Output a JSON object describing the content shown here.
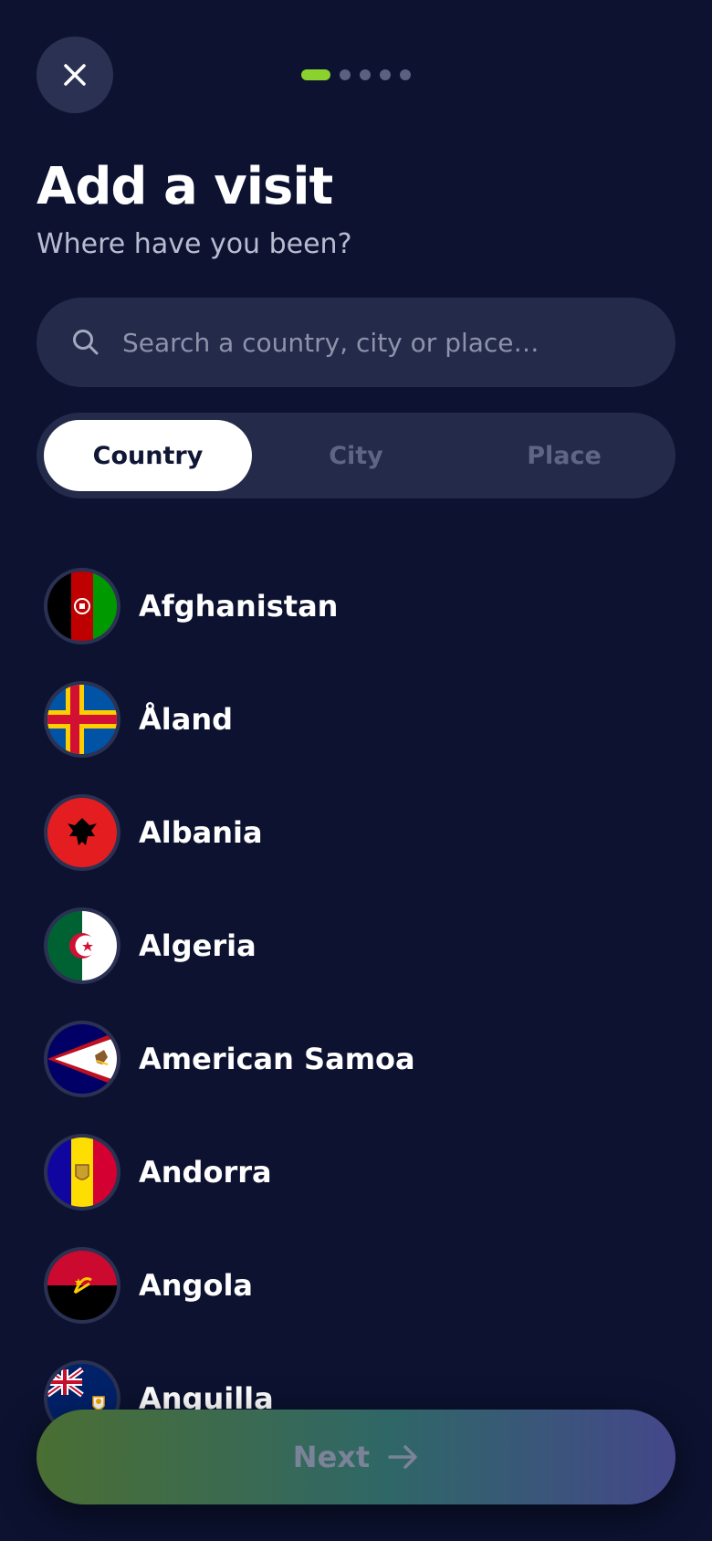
{
  "header": {
    "close_icon": "close-icon",
    "progress": {
      "total_steps": 5,
      "current_step": 1
    }
  },
  "title": "Add a visit",
  "subtitle": "Where have you been?",
  "search": {
    "icon": "search-icon",
    "placeholder": "Search a country, city or place…",
    "value": ""
  },
  "segments": [
    {
      "label": "Country",
      "selected": true
    },
    {
      "label": "City",
      "selected": false
    },
    {
      "label": "Place",
      "selected": false
    }
  ],
  "countries": [
    {
      "name": "Afghanistan",
      "flag_icon": "afghanistan-flag-icon"
    },
    {
      "name": "Åland",
      "flag_icon": "aland-flag-icon"
    },
    {
      "name": "Albania",
      "flag_icon": "albania-flag-icon"
    },
    {
      "name": "Algeria",
      "flag_icon": "algeria-flag-icon"
    },
    {
      "name": "American Samoa",
      "flag_icon": "american-samoa-flag-icon"
    },
    {
      "name": "Andorra",
      "flag_icon": "andorra-flag-icon"
    },
    {
      "name": "Angola",
      "flag_icon": "angola-flag-icon"
    },
    {
      "name": "Anguilla",
      "flag_icon": "anguilla-flag-icon"
    }
  ],
  "next_button": {
    "label": "Next",
    "icon": "arrow-right-icon"
  },
  "colors": {
    "background": "#0c1230",
    "surface": "#232a4a",
    "accent": "#8bd22e",
    "text_primary": "#ffffff",
    "text_secondary": "#b8bcd0"
  }
}
